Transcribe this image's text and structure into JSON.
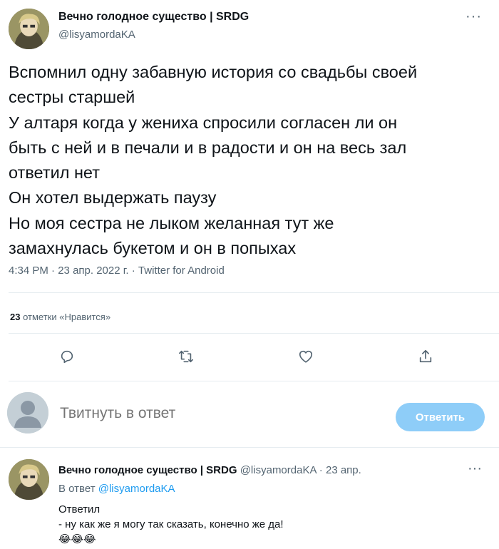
{
  "tweet": {
    "display_name": "Вечно голодное существо | SRDG",
    "handle": "@lisyamordaKA",
    "more": "···",
    "text": "Вспомнил одну забавную история со свадьбы своей\nсестры старшей\nУ алтаря когда у жениха спросили согласен ли он\nбыть с ней и в печали и в радости и он на весь зал\nответил нет\nОн хотел выдержать паузу\nНо моя сестра не лыком желанная тут же\nзамахнулась букетом и он в попыхах",
    "time": "4:34 PM",
    "date": "23 апр. 2022 г.",
    "source": "Twitter for Android",
    "separator": " · "
  },
  "stats": {
    "likes_count": "23",
    "likes_label": "отметки «Нравится»"
  },
  "actions": {
    "icons": [
      "reply-icon",
      "retweet-icon",
      "like-icon",
      "share-icon"
    ]
  },
  "compose": {
    "placeholder": "Твитнуть в ответ",
    "button_label": "Ответить",
    "button_color": "#8ecdf8"
  },
  "reply": {
    "display_name": "Вечно голодное существо | SRDG",
    "handle": "@lisyamordaKA",
    "date": "23 апр.",
    "separator": " · ",
    "more": "···",
    "reply_to_label": "В ответ",
    "reply_to_handle": "@lisyamordaKA",
    "text": "Ответил\n- ну как же я могу так сказать, конечно же да!\n😂😂😂"
  },
  "colors": {
    "text": "#0f1419",
    "secondary": "#536471",
    "link": "#1d9bf0",
    "divider": "#e6ecf0"
  }
}
